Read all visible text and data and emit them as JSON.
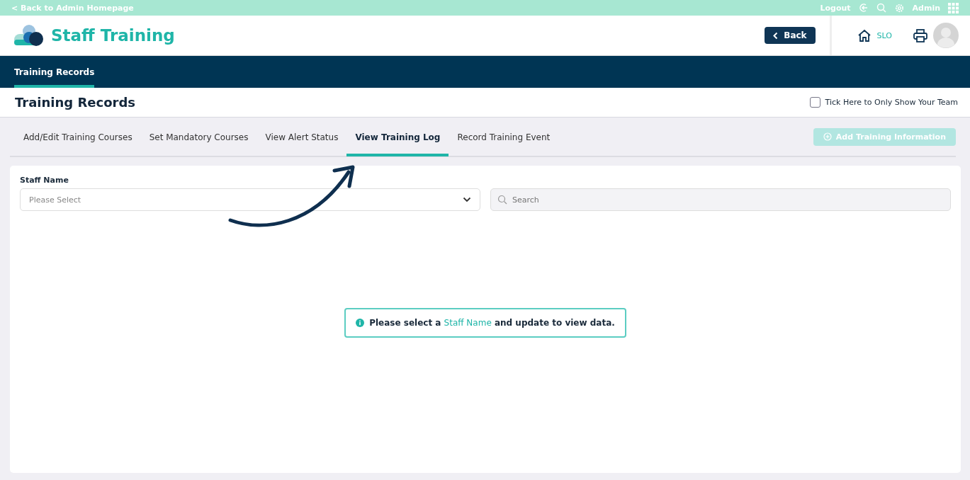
{
  "top_bar": {
    "back_link": "< Back to Admin Homepage",
    "logout": "Logout",
    "user": "Admin"
  },
  "header": {
    "title": "Staff Training",
    "back_button": "Back",
    "location": "SLO"
  },
  "nav": {
    "items": [
      {
        "label": "Training Records",
        "selected": true
      }
    ]
  },
  "page": {
    "title": "Training Records",
    "team_filter": {
      "label": "Tick Here to Only Show Your Team",
      "checked": false
    }
  },
  "tabs": [
    {
      "label": "Add/Edit Training Courses",
      "selected": false
    },
    {
      "label": "Set Mandatory Courses",
      "selected": false
    },
    {
      "label": "View Alert Status",
      "selected": false
    },
    {
      "label": "View Training Log",
      "selected": true
    },
    {
      "label": "Record Training Event",
      "selected": false
    }
  ],
  "add_button": {
    "label": "Add Training Information",
    "disabled": true
  },
  "form": {
    "staff_label": "Staff Name",
    "staff_placeholder": "Please Select",
    "search_placeholder": "Search"
  },
  "message": {
    "before": "Please select a",
    "highlight": "Staff Name",
    "after": "and update to view data."
  }
}
